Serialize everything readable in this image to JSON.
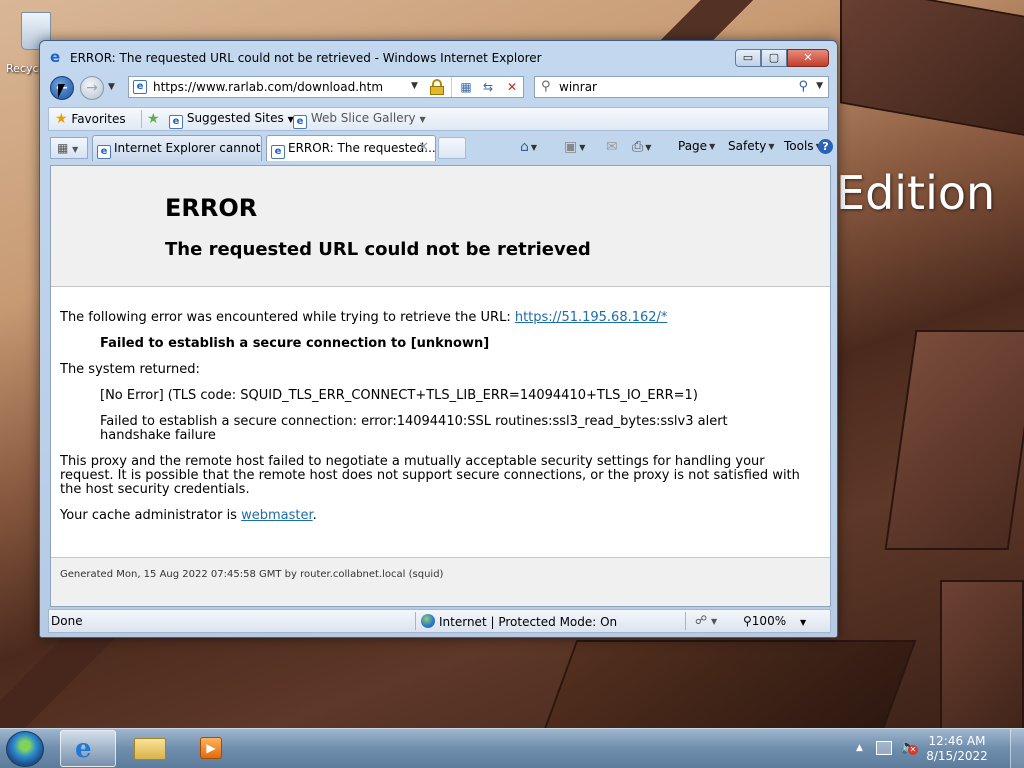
{
  "desktop": {
    "recycle_bin_label": "Recyc",
    "wallpaper_text": "Edition"
  },
  "window": {
    "title": "ERROR: The requested URL could not be retrieved - Windows Internet Explorer",
    "caption_buttons": {
      "minimize": "▭",
      "maximize": "▢",
      "close": "✕"
    }
  },
  "address_bar": {
    "url": "https://www.rarlab.com/download.htm"
  },
  "search": {
    "query": "winrar"
  },
  "favorites_bar": {
    "favorites_label": "Favorites",
    "suggested_sites": "Suggested Sites",
    "web_slice_gallery": "Web Slice Gallery"
  },
  "tabs": [
    {
      "label": "Internet Explorer cannot ...",
      "active": false
    },
    {
      "label": "ERROR: The requested...",
      "active": true
    }
  ],
  "command_bar": {
    "page": "Page",
    "safety": "Safety",
    "tools": "Tools",
    "help": "?"
  },
  "page": {
    "title": "ERROR",
    "subtitle": "The requested URL could not be retrieved",
    "intro": "The following error was encountered while trying to retrieve the URL: ",
    "intro_link": "https://51.195.68.162/*",
    "failure": "Failed to establish a secure connection to [unknown]",
    "system_returned": "The system returned:",
    "no_error": "[No Error] (TLS code: SQUID_TLS_ERR_CONNECT+TLS_LIB_ERR=14094410+TLS_IO_ERR=1)",
    "ssl_error": "Failed to establish a secure connection: error:14094410:SSL routines:ssl3_read_bytes:sslv3 alert handshake failure",
    "explanation": "This proxy and the remote host failed to negotiate a mutually acceptable security settings for handling your request. It is possible that the remote host does not support secure connections, or the proxy is not satisfied with the host security credentials.",
    "cache_admin_prefix": "Your cache administrator is ",
    "cache_admin_link": "webmaster",
    "cache_admin_suffix": ".",
    "footer": "Generated Mon, 15 Aug 2022 07:45:58 GMT by router.collabnet.local (squid)"
  },
  "status_bar": {
    "status": "Done",
    "zone": "Internet | Protected Mode: On",
    "zoom": "100%"
  },
  "taskbar": {
    "time": "12:46 AM",
    "date": "8/15/2022"
  }
}
